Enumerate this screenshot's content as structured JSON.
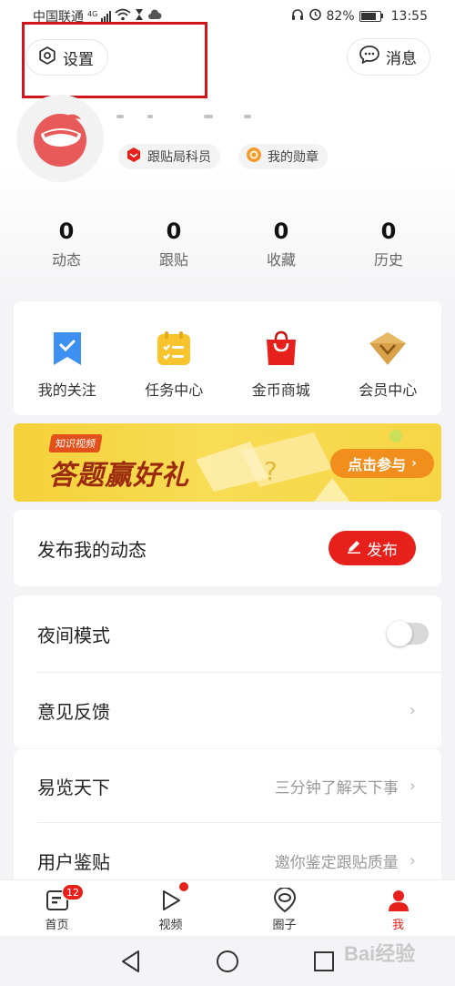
{
  "status_bar": {
    "carrier": "中国联通",
    "network": "4G",
    "battery": "82%",
    "time": "13:55"
  },
  "header": {
    "settings_label": "设置",
    "messages_label": "消息"
  },
  "profile": {
    "badges": [
      {
        "label": "跟贴局科员",
        "icon": "shield-icon",
        "color": "#e7201b"
      },
      {
        "label": "我的勋章",
        "icon": "medal-icon",
        "color": "#f39a2b"
      }
    ]
  },
  "stats": [
    {
      "value": "0",
      "label": "动态"
    },
    {
      "value": "0",
      "label": "跟贴"
    },
    {
      "value": "0",
      "label": "收藏"
    },
    {
      "value": "0",
      "label": "历史"
    }
  ],
  "quick_entries": [
    {
      "label": "我的关注",
      "icon": "bookmark-icon",
      "color": "#3d8ff0"
    },
    {
      "label": "任务中心",
      "icon": "task-list-icon",
      "color": "#f7c42d"
    },
    {
      "label": "金币商城",
      "icon": "shopping-bag-icon",
      "color": "#e7201b"
    },
    {
      "label": "会员中心",
      "icon": "diamond-icon",
      "color": "#d9a24a"
    }
  ],
  "banner": {
    "tag": "知识视频",
    "title": "答题赢好礼",
    "button": "点击参与"
  },
  "rows": {
    "publish": {
      "title": "发布我的动态",
      "button": "发布"
    },
    "night_mode": {
      "title": "夜间模式",
      "enabled": false
    },
    "feedback": {
      "title": "意见反馈"
    },
    "yilan": {
      "title": "易览天下",
      "hint": "三分钟了解天下事"
    },
    "appraise": {
      "title": "用户鉴贴",
      "hint": "邀你鉴定跟贴质量"
    }
  },
  "tab_bar": {
    "tabs": [
      {
        "label": "首页",
        "badge": "12"
      },
      {
        "label": "视频"
      },
      {
        "label": "圈子"
      },
      {
        "label": "我",
        "active": true
      }
    ]
  },
  "watermark": "Bai经验",
  "colors": {
    "accent": "#e7201b",
    "highlight": "#d0161b"
  }
}
